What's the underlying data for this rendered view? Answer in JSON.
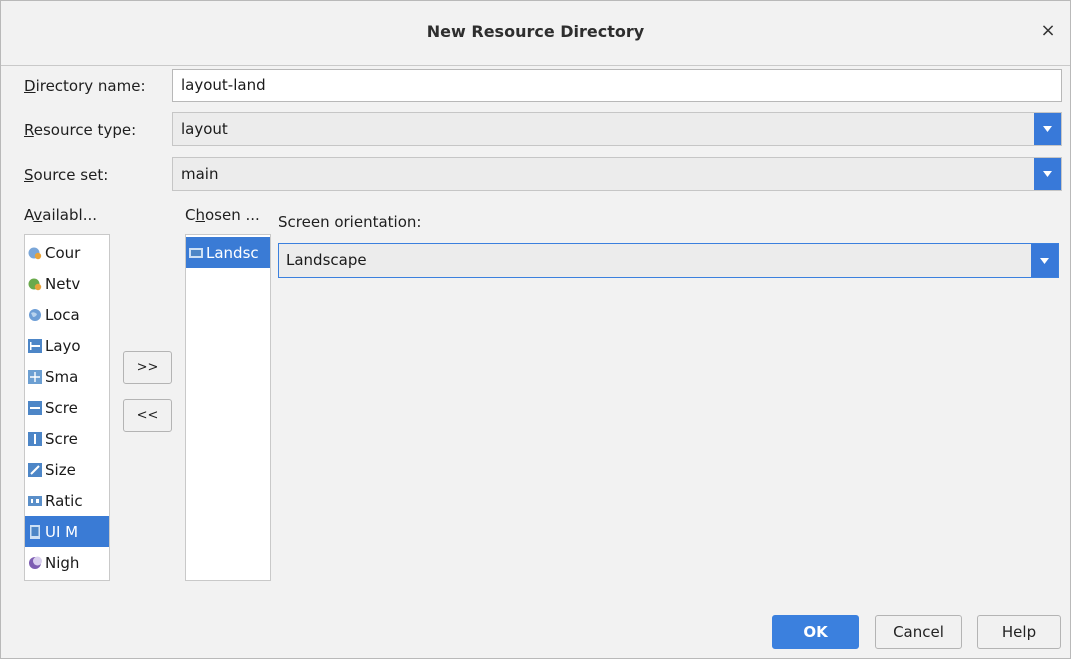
{
  "dialog": {
    "title": "New Resource Directory",
    "close_glyph": "×"
  },
  "fields": {
    "directory_name": {
      "label_mnemonic": "D",
      "label_rest": "irectory name:",
      "value": "layout-land"
    },
    "resource_type": {
      "label_mnemonic": "R",
      "label_rest": "esource type:",
      "value": "layout"
    },
    "source_set": {
      "label_mnemonic": "S",
      "label_rest": "ource set:",
      "value": "main"
    }
  },
  "available": {
    "label_pre": "A",
    "label_mnemonic": "v",
    "label_rest": "ailabl...",
    "items": [
      {
        "label": "Cour",
        "icon": "country-code-icon"
      },
      {
        "label": "Netv",
        "icon": "network-code-icon"
      },
      {
        "label": "Loca",
        "icon": "locale-icon"
      },
      {
        "label": "Layo",
        "icon": "layout-direction-icon"
      },
      {
        "label": "Sma",
        "icon": "smallest-screen-width-icon"
      },
      {
        "label": "Scre",
        "icon": "screen-width-icon"
      },
      {
        "label": "Scre",
        "icon": "screen-height-icon"
      },
      {
        "label": "Size",
        "icon": "size-icon"
      },
      {
        "label": "Ratic",
        "icon": "ratio-icon"
      },
      {
        "label": "UI M",
        "icon": "ui-mode-icon",
        "selected": true
      },
      {
        "label": "Nigh",
        "icon": "night-mode-icon"
      }
    ]
  },
  "chosen": {
    "label_pre": "C",
    "label_mnemonic": "h",
    "label_rest": "osen ...",
    "items": [
      {
        "label": "Landsc",
        "icon": "orientation-icon",
        "selected": true
      }
    ]
  },
  "transfer": {
    "add": ">>",
    "remove": "<<"
  },
  "orientation": {
    "label": "Screen orientation:",
    "value": "Landscape"
  },
  "buttons": {
    "ok": "OK",
    "cancel": "Cancel",
    "help": "Help"
  },
  "colors": {
    "accent": "#3b80de",
    "selection": "#3a7bd5"
  }
}
